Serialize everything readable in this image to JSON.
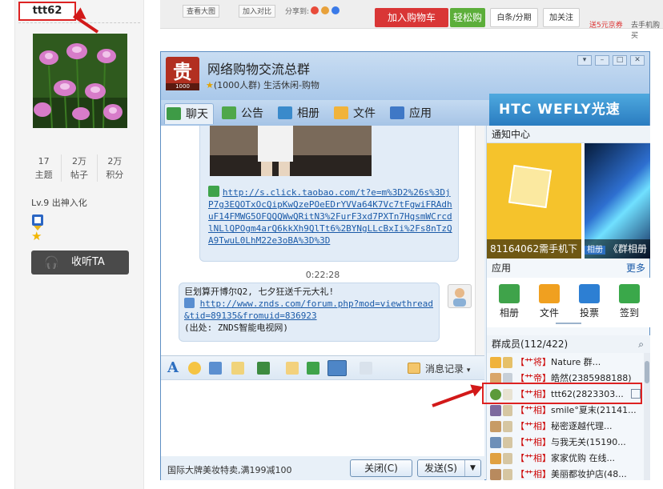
{
  "profile": {
    "username": "ttt62",
    "stats": [
      {
        "value": "17",
        "label": "主题"
      },
      {
        "value": "2万",
        "label": "帖子"
      },
      {
        "value": "2万",
        "label": "积分"
      }
    ],
    "level": "Lv.9 出神入化",
    "listen_label": "收听TA"
  },
  "topbar": {
    "view_image": "查看大图",
    "compare": "加入对比",
    "share_label": "分享到:",
    "add_cart": "加入购物车",
    "easy_buy": "轻松购",
    "installment": "白条/分期",
    "follow": "加关注",
    "promo_text": "送5元京券",
    "download_text": "去手机购买"
  },
  "qq": {
    "group_name": "网络购物交流总群",
    "group_info": "(1000人群) 生活休闲-购物",
    "logo_label": "1000",
    "tabs": [
      {
        "label": "聊天"
      },
      {
        "label": "公告"
      },
      {
        "label": "相册"
      },
      {
        "label": "文件"
      },
      {
        "label": "应用"
      }
    ],
    "ad_text": "HTC WEFLY光速",
    "chat": {
      "link1": "http://s.click.taobao.com/t?e=m%3D2%26s%3DjP7g3EQOTxOcQipKwQzePOeEDrYVVa64K7Vc7tFgwiFRAdhuF14FMWG5OFQQQWwQRitN3%2FurF3xd7PXTn7HgsmWCrcdlNLlQPOgm4arQ6kkXh9QlTt6%2BYNgLLcBxIi%2Fs8nTzQA9TwuL0LhM22e3oBA%3D%3D",
      "time": "0:22:28",
      "msg2_line1": "巨划算开博尔Q2, 七夕狂送千元大礼!",
      "link2": "http://www.znds.com/forum.php?mod=viewthread&tid=89135&fromuid=836923",
      "source": "(出处: ZNDS智能电视网)"
    },
    "history_label": "消息记录",
    "promo_bottom": "国际大牌美妆特卖,满199减100",
    "close_label": "关闭(C)",
    "send_label": "发送(S)",
    "notice_title": "通知中心",
    "notice_tile1": "81164062需手机下",
    "notice_tile2": "《群相册",
    "notice_tag": "相册",
    "apps_title": "应用",
    "apps_more": "更多",
    "apps": [
      {
        "label": "相册",
        "color": "#3fa34a"
      },
      {
        "label": "文件",
        "color": "#f0a020"
      },
      {
        "label": "投票",
        "color": "#2d7fd3"
      },
      {
        "label": "签到",
        "color": "#3aa84a"
      }
    ],
    "members_title": "群成员(112/422)",
    "members": [
      {
        "role": "【艹将】",
        "name": "Nature 群...",
        "color": "#f0b33c"
      },
      {
        "role": "【艹帝】",
        "name": "皓然(2385988188)",
        "color": "#d9a66a"
      },
      {
        "role": "【艹相】",
        "name": "ttt62(2823303...",
        "color": "#5c9a3a"
      },
      {
        "role": "【艹相】",
        "name": "smile°夏末(21141...",
        "color": "#7d6a9e"
      },
      {
        "role": "【艹相】",
        "name": "秘密逐越代理...",
        "color": "#c79b65"
      },
      {
        "role": "【艹相】",
        "name": "与我无关(15190...",
        "color": "#6d8fb8"
      },
      {
        "role": "【艹相】",
        "name": "家家优购 在线...",
        "color": "#e0a040"
      },
      {
        "role": "【艹相】",
        "name": "美丽都妆护店(48...",
        "color": "#b88a5e"
      }
    ]
  }
}
